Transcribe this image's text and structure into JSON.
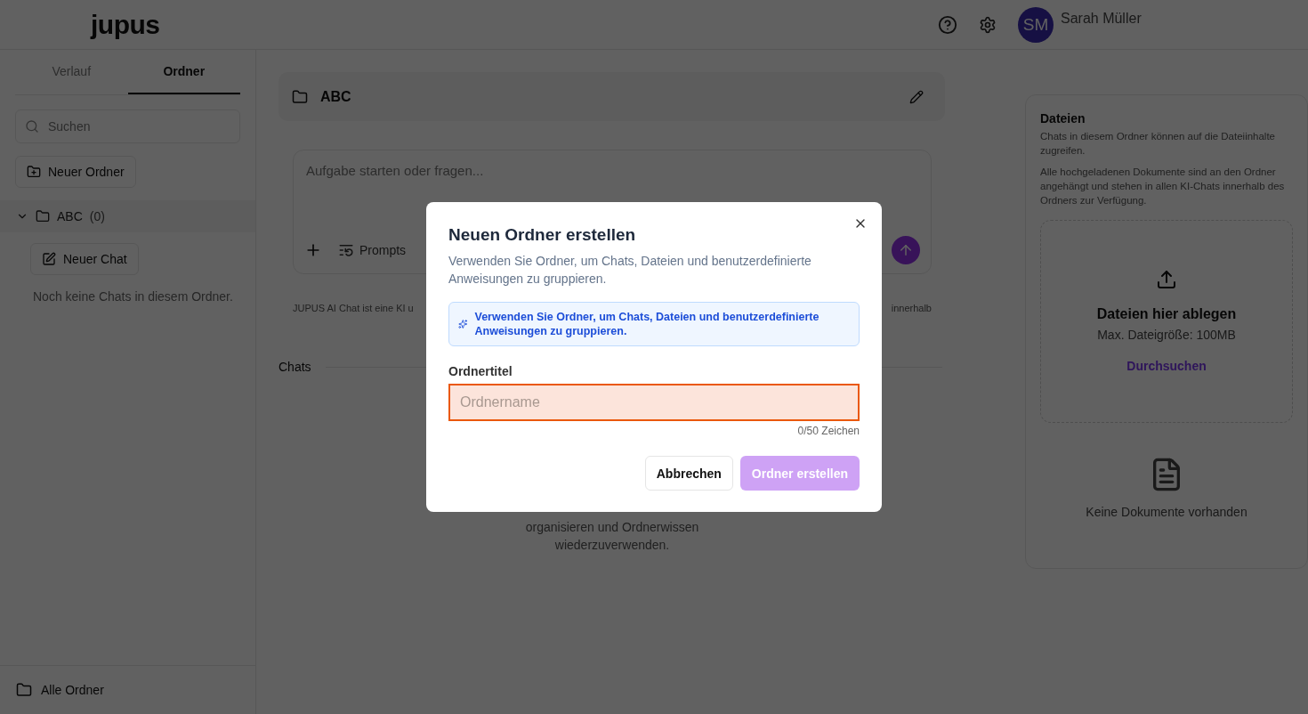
{
  "header": {
    "logo": "jupus",
    "user": {
      "initials": "SM",
      "name": "Sarah Müller"
    }
  },
  "sidebar": {
    "tabs": [
      {
        "label": "Verlauf",
        "selected": false
      },
      {
        "label": "Ordner",
        "selected": true
      }
    ],
    "search": {
      "placeholder": "Suchen"
    },
    "new_folder_button": "Neuer Ordner",
    "folders": [
      {
        "name": "ABC",
        "count": "(0)",
        "expanded": true,
        "new_chat_button": "Neuer Chat",
        "empty_text": "Noch keine Chats in diesem Ordner."
      }
    ],
    "footer": "Alle Ordner"
  },
  "main": {
    "folder_title": "ABC",
    "composer": {
      "placeholder": "Aufgabe starten oder fragen...",
      "prompts_label": "Prompts"
    },
    "disclaimer_start": "JUPUS AI Chat ist eine KI u",
    "disclaimer_end": "innerhalb",
    "chats_heading": "Chats",
    "empty_lines": [
      "organisieren und Ordnerwissen",
      "wiederzuverwenden."
    ]
  },
  "files_panel": {
    "title": "Dateien",
    "description": "Chats in diesem Ordner können auf die Dateiinhalte zugreifen.",
    "note": "Alle hochgeladenen Dokumente sind an den Ordner angehängt und stehen in allen KI-Chats innerhalb des Ordners zur Verfügung.",
    "dropzone": {
      "title": "Dateien hier ablegen",
      "limit": "Max. Dateigröße: 100MB",
      "browse": "Durchsuchen"
    },
    "empty_text": "Keine Dokumente vorhanden"
  },
  "dialog": {
    "title": "Neuen Ordner erstellen",
    "description": "Verwenden Sie Ordner, um Chats, Dateien und benutzerdefinierte Anweisungen zu gruppieren.",
    "info": "Verwenden Sie Ordner, um Chats, Dateien und benutzerdefinierte Anweisungen zu gruppieren.",
    "field_label": "Ordnertitel",
    "field": {
      "placeholder": "Ordnername",
      "invalid": true
    },
    "counter": "0/50 Zeichen",
    "cancel_button": "Abbrechen",
    "submit_button": {
      "label": "Ordner erstellen",
      "disabled": true
    }
  }
}
